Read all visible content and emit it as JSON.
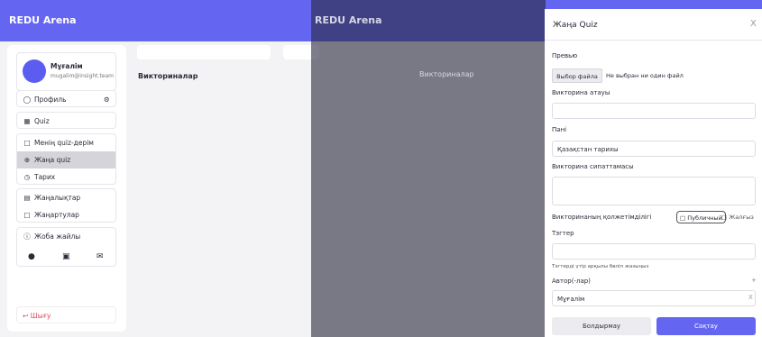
{
  "app": {
    "title": "REDU Arena"
  },
  "profile": {
    "name": "Мұғалім",
    "email": "mugalim@insight.team"
  },
  "sidebar": {
    "profile_label": "Профиль",
    "quiz_label": "Quiz",
    "my_quizzes": "Менің quiz-дерім",
    "new_quiz": "Жаңа quiz",
    "history": "Тарих",
    "news": "Жаңалықтар",
    "updates": "Жаңартулар",
    "project_pages": "Жоба жайлы",
    "logout": "Шығу"
  },
  "main": {
    "page_title": "Викториналар"
  },
  "modal": {
    "title": "Жаңа Quiz",
    "close": "X",
    "preview_label": "Превью",
    "file_button": "Выбор файла",
    "file_status": "Не выбран ни один файл",
    "name_label": "Викторина атауы",
    "name_value": "",
    "subject_label": "Пәні",
    "subject_value": "Қазақстан тарихы",
    "description_label": "Викторина сипаттамасы",
    "visibility_label": "Викторинаның қолжетімділігі",
    "visibility_public": "Публичный",
    "visibility_private": "Жалғыз",
    "tags_label": "Тэгтер",
    "tags_hint": "Тэгтерді үтір арқылы бөліп жазыңыз",
    "authors_label": "Автор(-лар)",
    "authors_add": "+",
    "author_value": "Мұғалім",
    "author_remove": "X",
    "cancel": "Болдырмау",
    "save": "Сақтау"
  },
  "colors": {
    "accent": "#6466f1",
    "danger": "#e0465a"
  },
  "icons": [
    "user-icon",
    "gear-icon",
    "quiz-icon",
    "folder-icon",
    "plus-circle-icon",
    "clock-icon",
    "news-icon",
    "square-icon",
    "info-icon",
    "github-icon",
    "instagram-icon",
    "mail-icon",
    "logout-icon"
  ]
}
